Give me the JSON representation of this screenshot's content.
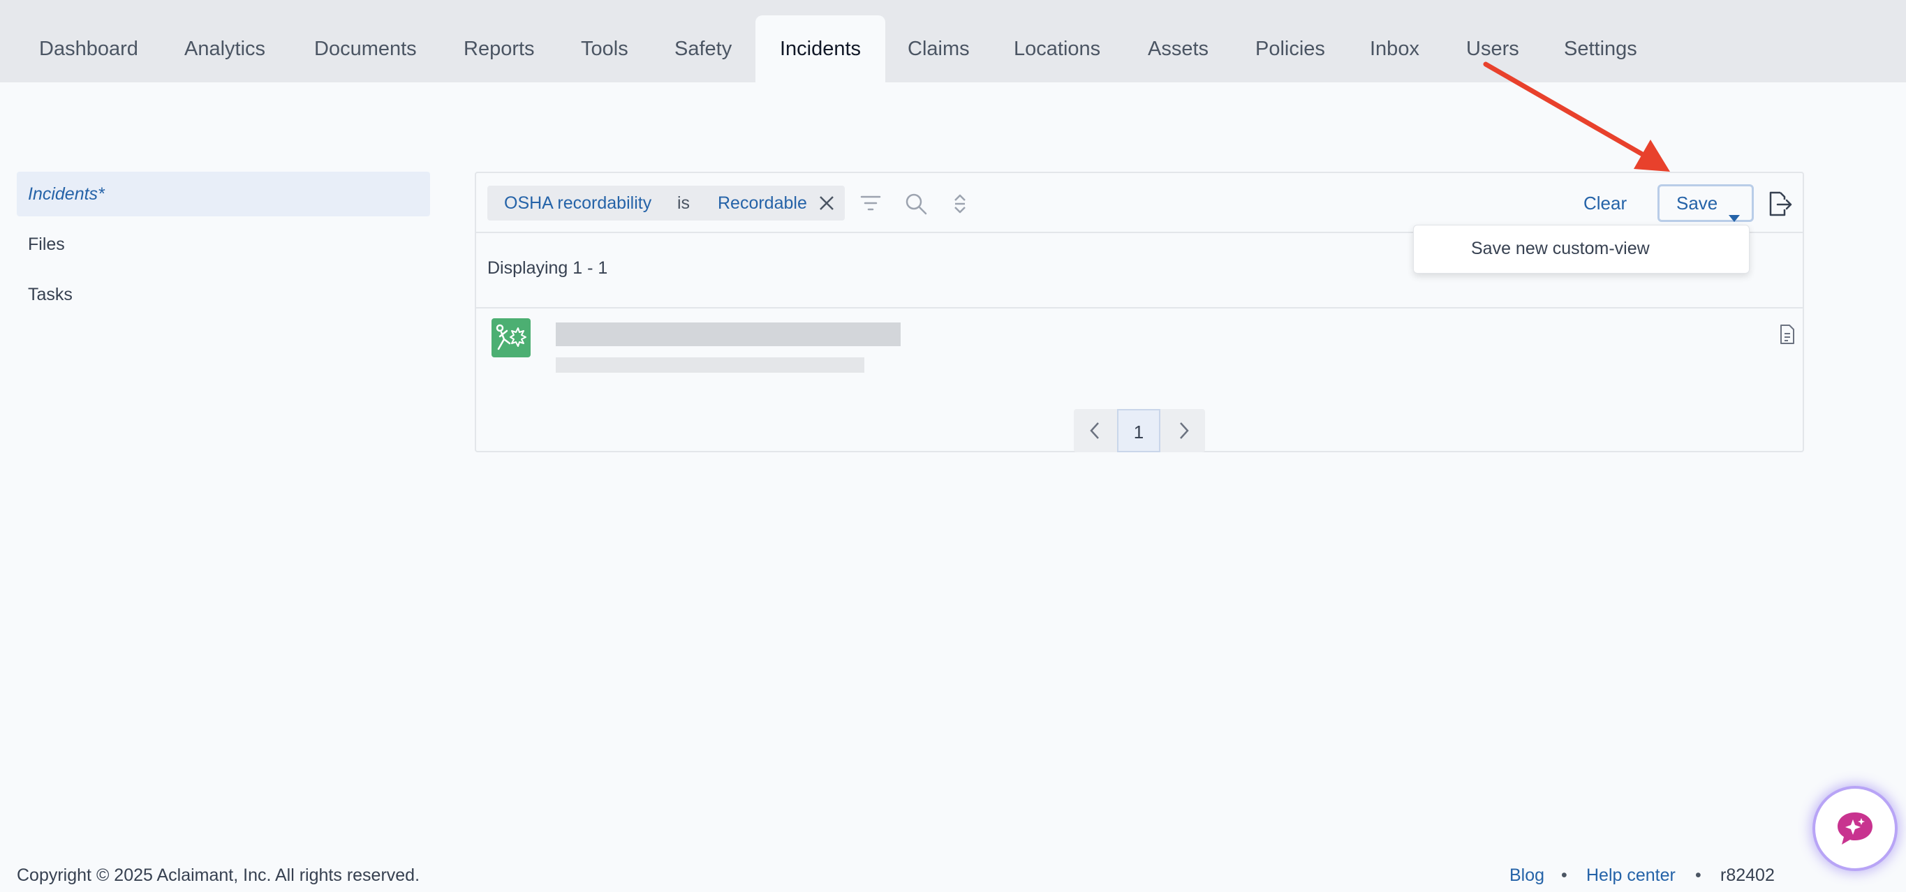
{
  "nav": {
    "tabs": [
      {
        "label": "Dashboard"
      },
      {
        "label": "Analytics"
      },
      {
        "label": "Documents"
      },
      {
        "label": "Reports"
      },
      {
        "label": "Tools"
      },
      {
        "label": "Safety"
      },
      {
        "label": "Incidents",
        "active": true
      },
      {
        "label": "Claims"
      },
      {
        "label": "Locations"
      },
      {
        "label": "Assets"
      },
      {
        "label": "Policies"
      },
      {
        "label": "Inbox"
      },
      {
        "label": "Users"
      },
      {
        "label": "Settings"
      }
    ]
  },
  "sidebar": {
    "items": [
      {
        "label": "Incidents*",
        "active": true
      },
      {
        "label": "Files"
      },
      {
        "label": "Tasks"
      }
    ]
  },
  "filter": {
    "field": "OSHA recordability",
    "operator": "is",
    "value": "Recordable"
  },
  "toolbar": {
    "clear_label": "Clear",
    "save_label": "Save"
  },
  "save_menu": {
    "items": [
      {
        "label": "Save new custom-view"
      }
    ]
  },
  "results": {
    "displaying": "Displaying 1 - 1"
  },
  "pagination": {
    "current_page": "1"
  },
  "footer": {
    "copyright": "Copyright © 2025 Aclaimant, Inc. All rights reserved.",
    "blog": "Blog",
    "help": "Help center",
    "separator": "•",
    "version": "r82402"
  },
  "colors": {
    "accent": "#2563a8",
    "annotation_arrow": "#e8412c",
    "incident_icon": "#4caf72",
    "chat_icon": "#c8338f"
  }
}
